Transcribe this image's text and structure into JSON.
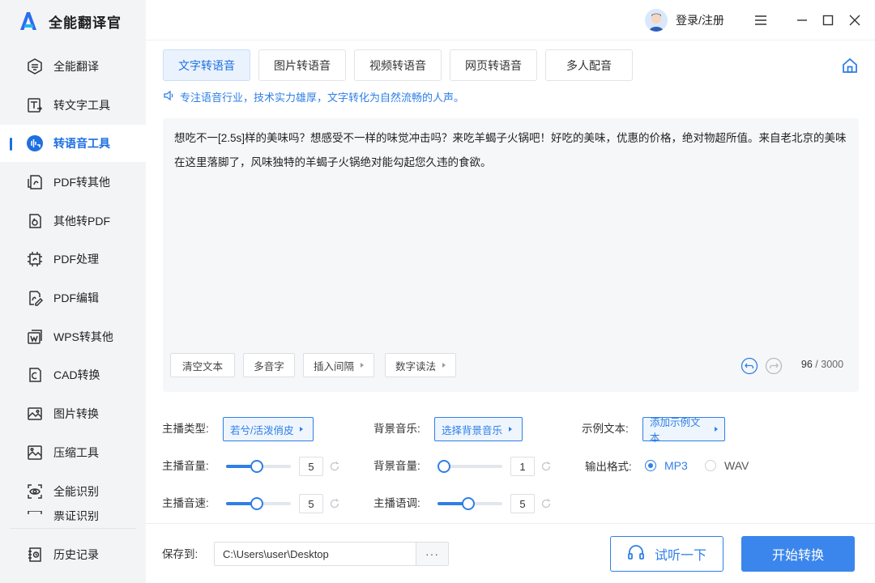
{
  "app": {
    "title": "全能翻译官"
  },
  "sidebar": {
    "items": [
      {
        "label": "全能翻译",
        "icon": "translate-icon"
      },
      {
        "label": "转文字工具",
        "icon": "text-convert-icon"
      },
      {
        "label": "转语音工具",
        "icon": "voice-convert-icon",
        "active": true
      },
      {
        "label": "PDF转其他",
        "icon": "pdf-export-icon"
      },
      {
        "label": "其他转PDF",
        "icon": "pdf-import-icon"
      },
      {
        "label": "PDF处理",
        "icon": "pdf-process-icon"
      },
      {
        "label": "PDF编辑",
        "icon": "pdf-edit-icon"
      },
      {
        "label": "WPS转其他",
        "icon": "wps-icon"
      },
      {
        "label": "CAD转换",
        "icon": "cad-icon"
      },
      {
        "label": "图片转换",
        "icon": "image-convert-icon"
      },
      {
        "label": "压缩工具",
        "icon": "compress-icon"
      },
      {
        "label": "全能识别",
        "icon": "recognize-icon"
      },
      {
        "label": "票证识别",
        "icon": "ticket-icon"
      }
    ],
    "history": {
      "label": "历史记录",
      "icon": "history-icon"
    }
  },
  "header": {
    "login_label": "登录/注册"
  },
  "tabs": [
    {
      "label": "文字转语音",
      "active": true
    },
    {
      "label": "图片转语音"
    },
    {
      "label": "视频转语音"
    },
    {
      "label": "网页转语音"
    },
    {
      "label": "多人配音"
    }
  ],
  "tip": "专注语音行业，技术实力雄厚，文字转化为自然流畅的人声。",
  "editor": {
    "text": "想吃不一[2.5s]样的美味吗？想感受不一样的味觉冲击吗？来吃羊蝎子火锅吧！好吃的美味，优惠的价格，绝对物超所值。来自老北京的美味在这里落脚了，风味独特的羊蝎子火锅绝对能勾起您久违的食欲。",
    "buttons": {
      "clear": "清空文本",
      "polyphone": "多音字",
      "insert_pause": "插入间隔",
      "number_reading": "数字读法"
    },
    "count": "96",
    "max": "3000"
  },
  "settings": {
    "anchor_type": {
      "label": "主播类型:",
      "value": "若兮/活泼俏皮"
    },
    "bg_music": {
      "label": "背景音乐:",
      "value": "选择背景音乐"
    },
    "sample_text": {
      "label": "示例文本:",
      "value": "添加示例文本"
    },
    "anchor_volume": {
      "label": "主播音量:",
      "value": "5",
      "level": 0.44
    },
    "bg_volume": {
      "label": "背景音量:",
      "value": "1",
      "level": 0.0
    },
    "anchor_speed": {
      "label": "主播音速:",
      "value": "5",
      "level": 0.44
    },
    "anchor_pitch": {
      "label": "主播语调:",
      "value": "5",
      "level": 0.44
    },
    "output_format": {
      "label": "输出格式:",
      "options": [
        "MP3",
        "WAV"
      ],
      "selected": "MP3"
    }
  },
  "footer": {
    "save_label": "保存到:",
    "path": "C:\\Users\\user\\Desktop",
    "more": "···",
    "listen_label": "试听一下",
    "start_label": "开始转换"
  },
  "colors": {
    "accent": "#2f7fe6",
    "sidebar_bg": "#f3f4f6",
    "primary_button": "#3a86ec"
  }
}
